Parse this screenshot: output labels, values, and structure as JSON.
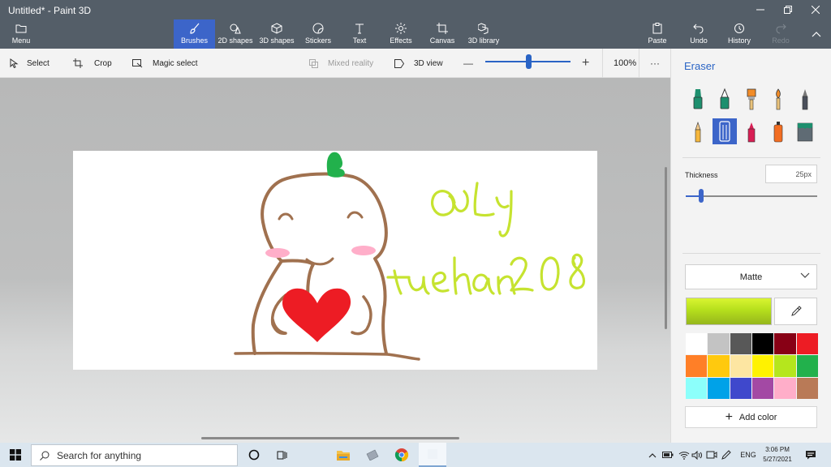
{
  "window": {
    "title": "Untitled* - Paint 3D"
  },
  "toolbar": {
    "menu": "Menu",
    "tabs": [
      {
        "label": "Brushes"
      },
      {
        "label": "2D shapes"
      },
      {
        "label": "3D shapes"
      },
      {
        "label": "Stickers"
      },
      {
        "label": "Text"
      },
      {
        "label": "Effects"
      },
      {
        "label": "Canvas"
      },
      {
        "label": "3D library"
      }
    ],
    "paste": "Paste",
    "undo": "Undo",
    "history": "History",
    "redo": "Redo"
  },
  "subtoolbar": {
    "select": "Select",
    "crop": "Crop",
    "magic_select": "Magic select",
    "mixed_reality": "Mixed reality",
    "view_3d": "3D view",
    "zoom_minus": "—",
    "zoom_plus": "+",
    "zoom": "100%",
    "more": "···",
    "zoom_level_fraction": 0.5
  },
  "panel": {
    "title": "Eraser",
    "thickness_label": "Thickness",
    "thickness_value": "25px",
    "thickness_fraction": 0.12,
    "finish": "Matte",
    "current_color": "#b5df1c",
    "palette": [
      "#ffffff",
      "#c3c3c3",
      "#585858",
      "#000000",
      "#880015",
      "#ed1c24",
      "#ff7f27",
      "#ffc90e",
      "#fde6a2",
      "#fff200",
      "#b5e61d",
      "#22b14c",
      "#8cfffb",
      "#00a2e8",
      "#3f48cc",
      "#a349a4",
      "#ffaec9",
      "#b97a57"
    ],
    "add_color": "Add color"
  },
  "drawing": {
    "text_line1": "@Ly",
    "text_line2": "tuehan208",
    "line_color": "#a0714f",
    "text_color": "#c6e330",
    "sprout_color": "#22b14c",
    "heart_color": "#ed1c24",
    "blush_color": "#ffaec9"
  },
  "taskbar": {
    "search_placeholder": "Search for anything",
    "language": "ENG",
    "time": "3:06 PM",
    "date": "5/27/2021"
  }
}
